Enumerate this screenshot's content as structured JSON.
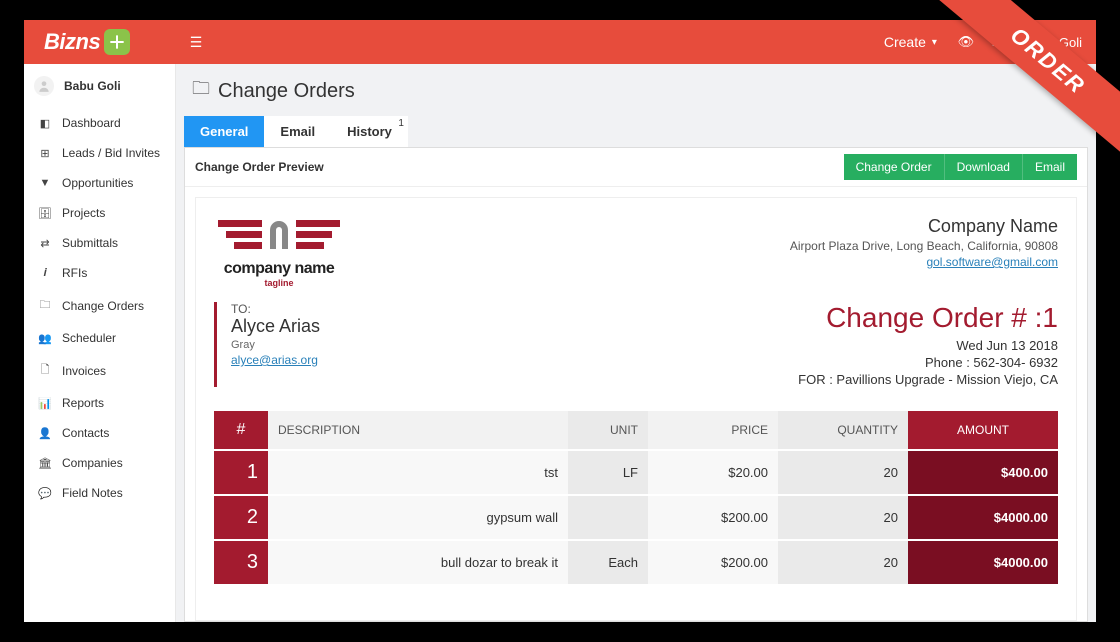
{
  "brand": {
    "name": "Bizns"
  },
  "topbar": {
    "create_label": "Create",
    "user_name": "Babu Goli"
  },
  "sidebar": {
    "user_name": "Babu Goli",
    "items": [
      {
        "icon": "dashboard",
        "label": "Dashboard"
      },
      {
        "icon": "leads",
        "label": "Leads / Bid Invites"
      },
      {
        "icon": "opportunities",
        "label": "Opportunities"
      },
      {
        "icon": "projects",
        "label": "Projects"
      },
      {
        "icon": "submittals",
        "label": "Submittals"
      },
      {
        "icon": "rfis",
        "label": "RFIs"
      },
      {
        "icon": "change-orders",
        "label": "Change Orders"
      },
      {
        "icon": "scheduler",
        "label": "Scheduler"
      },
      {
        "icon": "invoices",
        "label": "Invoices"
      },
      {
        "icon": "reports",
        "label": "Reports"
      },
      {
        "icon": "contacts",
        "label": "Contacts"
      },
      {
        "icon": "companies",
        "label": "Companies"
      },
      {
        "icon": "field-notes",
        "label": "Field Notes"
      }
    ]
  },
  "page": {
    "title": "Change Orders",
    "tabs": {
      "general": "General",
      "email": "Email",
      "history": "History",
      "history_count": "1"
    },
    "panel_title": "Change Order Preview",
    "buttons": {
      "change_order": "Change Order",
      "download": "Download",
      "email": "Email"
    }
  },
  "ribbon": {
    "text": "ORDER"
  },
  "doc": {
    "company_logo_name": "company name",
    "company_logo_tag": "tagline",
    "company_name": "Company Name",
    "company_address": "Airport Plaza Drive, Long Beach, California, 90808",
    "company_email": "gol.software@gmail.com",
    "to_label": "TO:",
    "to_name": "Alyce Arias",
    "to_sub": "Gray",
    "to_email": "alyce@arias.org",
    "title": "Change Order # :1",
    "date": "Wed Jun 13 2018",
    "phone": "Phone : 562-304- 6932",
    "for": "FOR : Pavillions Upgrade - Mission Viejo, CA",
    "headers": {
      "num": "#",
      "description": "DESCRIPTION",
      "unit": "UNIT",
      "price": "PRICE",
      "quantity": "QUANTITY",
      "amount": "AMOUNT"
    },
    "rows": [
      {
        "num": "1",
        "description": "tst",
        "unit": "LF",
        "price": "$20.00",
        "quantity": "20",
        "amount": "$400.00"
      },
      {
        "num": "2",
        "description": "gypsum wall",
        "unit": "",
        "price": "$200.00",
        "quantity": "20",
        "amount": "$4000.00"
      },
      {
        "num": "3",
        "description": "bull dozar to break it",
        "unit": "Each",
        "price": "$200.00",
        "quantity": "20",
        "amount": "$4000.00"
      }
    ]
  }
}
